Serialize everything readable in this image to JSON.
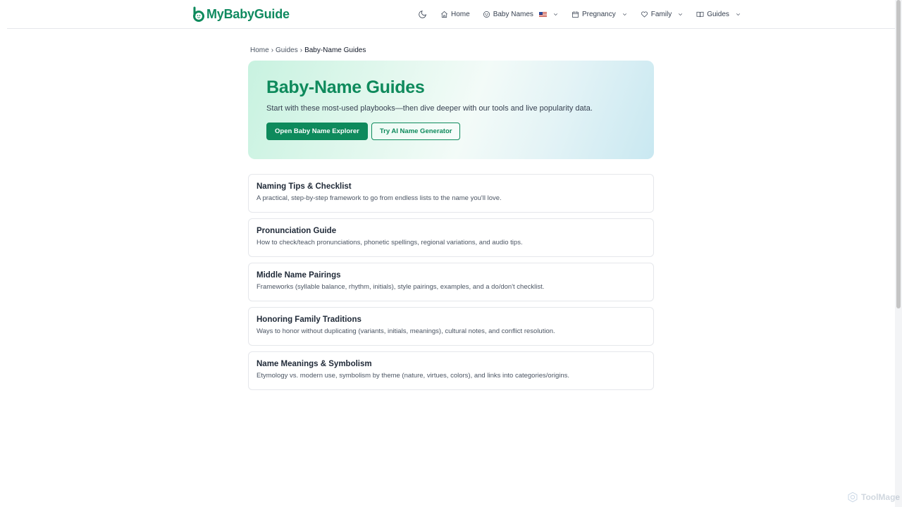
{
  "header": {
    "logo_text": "MyBabyGuide",
    "nav": {
      "theme_toggle_icon": "moon-icon",
      "home_label": "Home",
      "baby_names_label": "Baby Names",
      "pregnancy_label": "Pregnancy",
      "family_label": "Family",
      "guides_label": "Guides"
    }
  },
  "breadcrumb": {
    "home": "Home",
    "sep1": "›",
    "guides": "Guides",
    "sep2": "›",
    "current": "Baby-Name Guides"
  },
  "hero": {
    "title": "Baby-Name Guides",
    "subtitle": "Start with these most-used playbooks—then dive deeper with our tools and live popularity data.",
    "primary_button": "Open Baby Name Explorer",
    "secondary_button": "Try AI Name Generator"
  },
  "guides": [
    {
      "title": "Naming Tips & Checklist",
      "description": "A practical, step-by-step framework to go from endless lists to the name you'll love."
    },
    {
      "title": "Pronunciation Guide",
      "description": "How to check/teach pronunciations, phonetic spellings, regional variations, and audio tips."
    },
    {
      "title": "Middle Name Pairings",
      "description": "Frameworks (syllable balance, rhythm, initials), style pairings, examples, and a do/don't checklist."
    },
    {
      "title": "Honoring Family Traditions",
      "description": "Ways to honor without duplicating (variants, initials, meanings), cultural notes, and conflict resolution."
    },
    {
      "title": "Name Meanings & Symbolism",
      "description": "Etymology vs. modern use, symbolism by theme (nature, virtues, colors), and links into categories/origins."
    }
  ],
  "watermark": "ToolMage",
  "colors": {
    "brand": "#0e8a5c",
    "text": "#1f2937",
    "muted": "#4b5563",
    "border": "#e5e7eb"
  }
}
